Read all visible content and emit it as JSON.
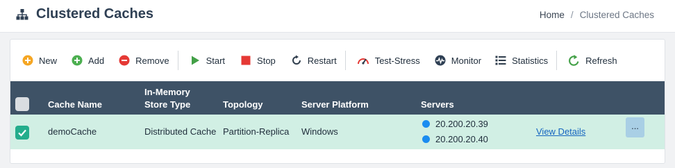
{
  "header": {
    "title": "Clustered Caches",
    "title_icon": "sitemap-icon",
    "breadcrumb": {
      "home": "Home",
      "separator": "/",
      "current": "Clustered Caches"
    }
  },
  "toolbar": {
    "new": "New",
    "add": "Add",
    "remove": "Remove",
    "start": "Start",
    "stop": "Stop",
    "restart": "Restart",
    "test_stress": "Test-Stress",
    "monitor": "Monitor",
    "statistics": "Statistics",
    "refresh": "Refresh"
  },
  "table": {
    "columns": {
      "cache_name": "Cache Name",
      "store_type_line1": "In-Memory",
      "store_type_line2": "Store Type",
      "topology": "Topology",
      "platform": "Server Platform",
      "servers": "Servers"
    },
    "rows": [
      {
        "checked": true,
        "cache_name": "demoCache",
        "store_type": "Distributed Cache",
        "topology": "Partition-Replica",
        "platform": "Windows",
        "servers": [
          "20.200.20.39",
          "20.200.20.40"
        ],
        "details_link": "View Details",
        "more": "..."
      }
    ]
  },
  "colors": {
    "header_bg": "#3e5266",
    "row_selected_bg": "#d1efe4",
    "checkbox_checked": "#23ad8c",
    "server_dot": "#1a8cf0",
    "link": "#1565c0"
  }
}
